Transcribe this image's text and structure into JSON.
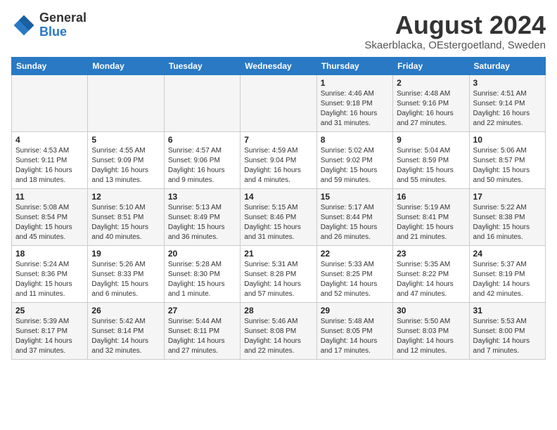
{
  "header": {
    "logo_line1": "General",
    "logo_line2": "Blue",
    "month_year": "August 2024",
    "location": "Skaerblacka, OEstergoetland, Sweden"
  },
  "days_of_week": [
    "Sunday",
    "Monday",
    "Tuesday",
    "Wednesday",
    "Thursday",
    "Friday",
    "Saturday"
  ],
  "weeks": [
    [
      {
        "day": "",
        "info": ""
      },
      {
        "day": "",
        "info": ""
      },
      {
        "day": "",
        "info": ""
      },
      {
        "day": "",
        "info": ""
      },
      {
        "day": "1",
        "info": "Sunrise: 4:46 AM\nSunset: 9:18 PM\nDaylight: 16 hours\nand 31 minutes."
      },
      {
        "day": "2",
        "info": "Sunrise: 4:48 AM\nSunset: 9:16 PM\nDaylight: 16 hours\nand 27 minutes."
      },
      {
        "day": "3",
        "info": "Sunrise: 4:51 AM\nSunset: 9:14 PM\nDaylight: 16 hours\nand 22 minutes."
      }
    ],
    [
      {
        "day": "4",
        "info": "Sunrise: 4:53 AM\nSunset: 9:11 PM\nDaylight: 16 hours\nand 18 minutes."
      },
      {
        "day": "5",
        "info": "Sunrise: 4:55 AM\nSunset: 9:09 PM\nDaylight: 16 hours\nand 13 minutes."
      },
      {
        "day": "6",
        "info": "Sunrise: 4:57 AM\nSunset: 9:06 PM\nDaylight: 16 hours\nand 9 minutes."
      },
      {
        "day": "7",
        "info": "Sunrise: 4:59 AM\nSunset: 9:04 PM\nDaylight: 16 hours\nand 4 minutes."
      },
      {
        "day": "8",
        "info": "Sunrise: 5:02 AM\nSunset: 9:02 PM\nDaylight: 15 hours\nand 59 minutes."
      },
      {
        "day": "9",
        "info": "Sunrise: 5:04 AM\nSunset: 8:59 PM\nDaylight: 15 hours\nand 55 minutes."
      },
      {
        "day": "10",
        "info": "Sunrise: 5:06 AM\nSunset: 8:57 PM\nDaylight: 15 hours\nand 50 minutes."
      }
    ],
    [
      {
        "day": "11",
        "info": "Sunrise: 5:08 AM\nSunset: 8:54 PM\nDaylight: 15 hours\nand 45 minutes."
      },
      {
        "day": "12",
        "info": "Sunrise: 5:10 AM\nSunset: 8:51 PM\nDaylight: 15 hours\nand 40 minutes."
      },
      {
        "day": "13",
        "info": "Sunrise: 5:13 AM\nSunset: 8:49 PM\nDaylight: 15 hours\nand 36 minutes."
      },
      {
        "day": "14",
        "info": "Sunrise: 5:15 AM\nSunset: 8:46 PM\nDaylight: 15 hours\nand 31 minutes."
      },
      {
        "day": "15",
        "info": "Sunrise: 5:17 AM\nSunset: 8:44 PM\nDaylight: 15 hours\nand 26 minutes."
      },
      {
        "day": "16",
        "info": "Sunrise: 5:19 AM\nSunset: 8:41 PM\nDaylight: 15 hours\nand 21 minutes."
      },
      {
        "day": "17",
        "info": "Sunrise: 5:22 AM\nSunset: 8:38 PM\nDaylight: 15 hours\nand 16 minutes."
      }
    ],
    [
      {
        "day": "18",
        "info": "Sunrise: 5:24 AM\nSunset: 8:36 PM\nDaylight: 15 hours\nand 11 minutes."
      },
      {
        "day": "19",
        "info": "Sunrise: 5:26 AM\nSunset: 8:33 PM\nDaylight: 15 hours\nand 6 minutes."
      },
      {
        "day": "20",
        "info": "Sunrise: 5:28 AM\nSunset: 8:30 PM\nDaylight: 15 hours\nand 1 minute."
      },
      {
        "day": "21",
        "info": "Sunrise: 5:31 AM\nSunset: 8:28 PM\nDaylight: 14 hours\nand 57 minutes."
      },
      {
        "day": "22",
        "info": "Sunrise: 5:33 AM\nSunset: 8:25 PM\nDaylight: 14 hours\nand 52 minutes."
      },
      {
        "day": "23",
        "info": "Sunrise: 5:35 AM\nSunset: 8:22 PM\nDaylight: 14 hours\nand 47 minutes."
      },
      {
        "day": "24",
        "info": "Sunrise: 5:37 AM\nSunset: 8:19 PM\nDaylight: 14 hours\nand 42 minutes."
      }
    ],
    [
      {
        "day": "25",
        "info": "Sunrise: 5:39 AM\nSunset: 8:17 PM\nDaylight: 14 hours\nand 37 minutes."
      },
      {
        "day": "26",
        "info": "Sunrise: 5:42 AM\nSunset: 8:14 PM\nDaylight: 14 hours\nand 32 minutes."
      },
      {
        "day": "27",
        "info": "Sunrise: 5:44 AM\nSunset: 8:11 PM\nDaylight: 14 hours\nand 27 minutes."
      },
      {
        "day": "28",
        "info": "Sunrise: 5:46 AM\nSunset: 8:08 PM\nDaylight: 14 hours\nand 22 minutes."
      },
      {
        "day": "29",
        "info": "Sunrise: 5:48 AM\nSunset: 8:05 PM\nDaylight: 14 hours\nand 17 minutes."
      },
      {
        "day": "30",
        "info": "Sunrise: 5:50 AM\nSunset: 8:03 PM\nDaylight: 14 hours\nand 12 minutes."
      },
      {
        "day": "31",
        "info": "Sunrise: 5:53 AM\nSunset: 8:00 PM\nDaylight: 14 hours\nand 7 minutes."
      }
    ]
  ]
}
